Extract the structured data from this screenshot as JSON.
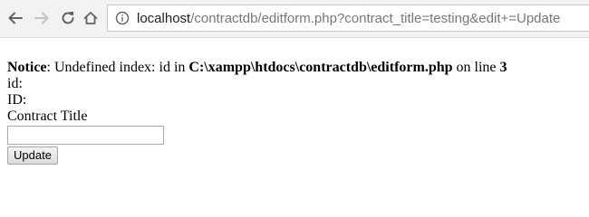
{
  "browser": {
    "url_host": "localhost",
    "url_path": "/contractdb/editform.php?contract_title=testing&edit+=Update",
    "icons": {
      "back": "arrow-left-icon",
      "forward": "arrow-right-icon",
      "reload": "reload-icon",
      "home": "home-icon",
      "info": "info-icon"
    }
  },
  "page": {
    "notice_label": "Notice",
    "notice_text_1": ": Undefined index: id in ",
    "notice_path": "C:\\xampp\\htdocs\\contractdb\\editform.php",
    "notice_text_2": " on line ",
    "notice_line": "3",
    "id_line_lower": "id:",
    "id_line_upper": "ID:",
    "contract_title_label": "Contract Title",
    "contract_title_value": "",
    "update_button_label": "Update"
  }
}
